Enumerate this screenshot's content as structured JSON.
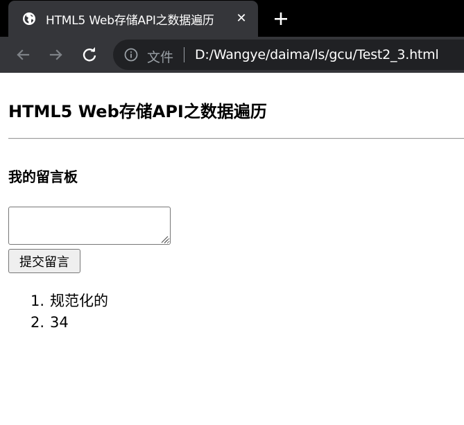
{
  "browser": {
    "tab": {
      "title": "HTML5 Web存储API之数据遍历",
      "close_glyph": "✕",
      "favicon": "globe-icon"
    },
    "toolbar": {
      "security_label": "文件",
      "url": "D:/Wangye/daima/ls/gcu/Test2_3.html"
    }
  },
  "page": {
    "title": "HTML5 Web存储API之数据遍历",
    "board_title": "我的留言板",
    "message_input": {
      "value": "",
      "placeholder": ""
    },
    "submit_label": "提交留言",
    "messages": [
      {
        "num": "1.",
        "text": "规范化的"
      },
      {
        "num": "2.",
        "text": "34"
      }
    ]
  },
  "colors": {
    "tabstrip_bg": "#000000",
    "toolbar_bg": "#35363a",
    "omnibox_bg": "#202124",
    "muted_text": "#9aa0a6"
  }
}
